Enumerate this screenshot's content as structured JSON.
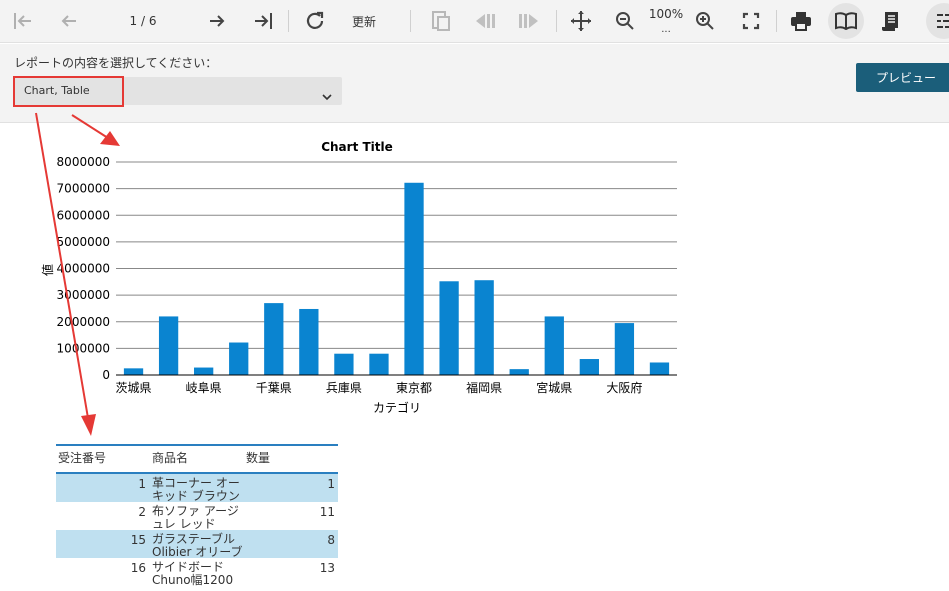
{
  "toolbar": {
    "page_indicator": "1 / 6",
    "refresh_label": "更新",
    "zoom_label": "100%",
    "zoom_more": "..."
  },
  "params": {
    "label": "レポートの内容を選択してください：",
    "select_value": "Chart, Table",
    "preview_label": "プレビュー"
  },
  "colors": {
    "bar": "#0a84d0",
    "highlight": "#e53935",
    "button": "#1b5e7a",
    "table_alt": "#bfe0f0",
    "table_rule": "#2a7fc0"
  },
  "chart_data": {
    "type": "bar",
    "title": "Chart Title",
    "xlabel": "カテゴリ",
    "ylabel": "値",
    "ylim": [
      0,
      8000000
    ],
    "yticks": [
      "0",
      "1000000",
      "2000000",
      "3000000",
      "4000000",
      "5000000",
      "6000000",
      "7000000",
      "8000000"
    ],
    "grid": true,
    "category_labels": [
      "茨城県",
      "岐阜県",
      "千葉県",
      "兵庫県",
      "東京都",
      "福岡県",
      "宮城県",
      "大阪府"
    ],
    "values": [
      250000,
      2200000,
      280000,
      1220000,
      2700000,
      2480000,
      800000,
      800000,
      7220000,
      3520000,
      3560000,
      220000,
      2200000,
      600000,
      1950000,
      470000
    ]
  },
  "table": {
    "headers": [
      "受注番号",
      "商品名",
      "数量"
    ],
    "rows": [
      {
        "id": "1",
        "name": "革コーナー オーキッド ブラウン",
        "qty": "1"
      },
      {
        "id": "2",
        "name": "布ソファ アージュレ レッド",
        "qty": "11"
      },
      {
        "id": "15",
        "name": "ガラステーブル Olibier オリーブ",
        "qty": "8"
      },
      {
        "id": "16",
        "name": "サイドボード Chuno幅1200",
        "qty": "13"
      }
    ]
  }
}
